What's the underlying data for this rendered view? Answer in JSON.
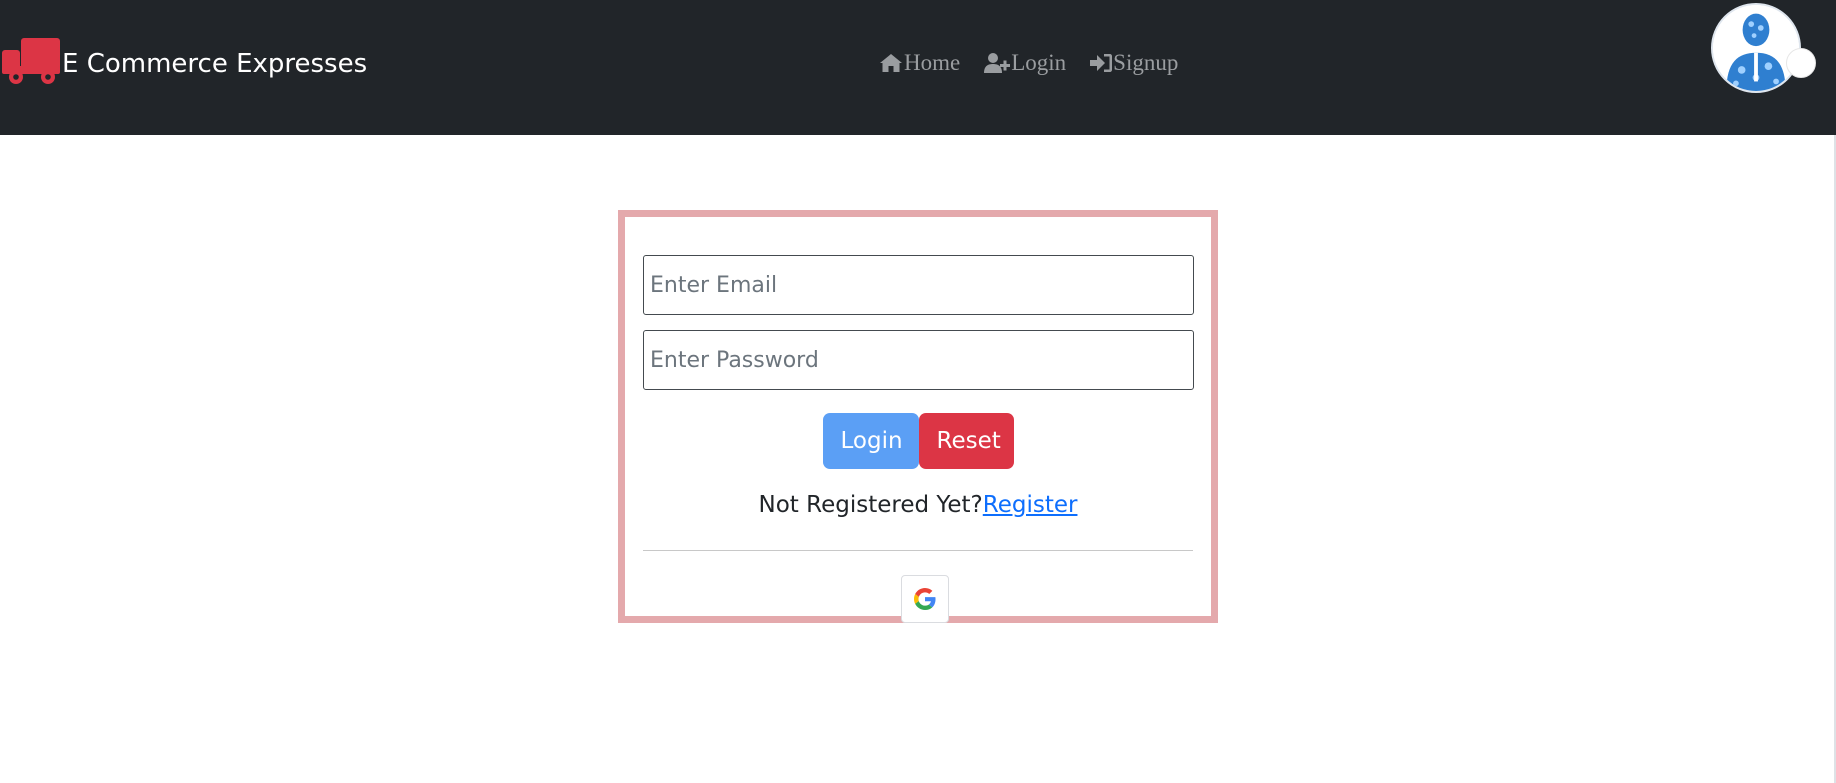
{
  "navbar": {
    "brand_icon": "truck-icon",
    "brand_text": "E Commerce Expresses",
    "links": [
      {
        "label": "Home",
        "icon": "home-icon"
      },
      {
        "label": "Login",
        "icon": "user-plus-icon"
      },
      {
        "label": "Signup",
        "icon": "sign-in-icon"
      }
    ],
    "avatar_icon": "avatar"
  },
  "login_form": {
    "email_placeholder": "Enter Email",
    "email_value": "",
    "password_placeholder": "Enter Password",
    "password_value": "",
    "login_button": "Login",
    "reset_button": "Reset",
    "register_prompt": "Not Registered Yet?",
    "register_link": "Register",
    "google_icon": "google-icon"
  },
  "colors": {
    "navbar_bg": "#212529",
    "brand_icon": "#dc3545",
    "nav_link": "#9a9da0",
    "card_border": "#e4a9ac",
    "login_button": "#5b9ff5",
    "reset_button": "#dc3545",
    "link": "#0d6efd"
  }
}
